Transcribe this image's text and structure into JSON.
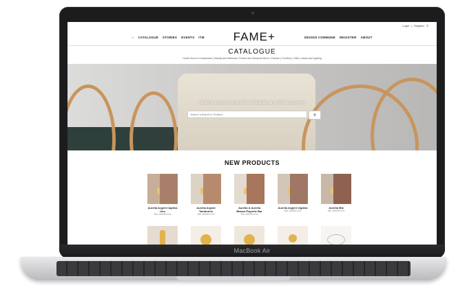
{
  "device": {
    "brand_label": "MacBook Air"
  },
  "site": {
    "topbar": {
      "login": "Login",
      "register": "Register"
    },
    "nav": {
      "left": [
        "CATALOGUE",
        "STORIES",
        "EVENTS",
        "ITM"
      ],
      "logo": "FAME+",
      "right": [
        "DESIGN COMMUNE",
        "REGISTER",
        "ABOUT"
      ]
    },
    "catalogue": {
      "title": "CATALOGUE",
      "links": "Home Decor & Housewares | Beauty and Wellness | Festive and Seasonal Decor | Fashion | Furniture | Gifts | Lamps and Lighting"
    },
    "hero": {
      "text": "Search across hundreds of Brands and Products here",
      "search_placeholder": "Search a Brand or Product"
    },
    "new_products": {
      "title": "NEW PRODUCTS",
      "items": [
        {
          "name": "Aurelia Argent Captiva Uno",
          "brand": "MA. ANGELICA"
        },
        {
          "name": "Aurelia Argent Tamborine",
          "brand": "MA. ANGELICA"
        },
        {
          "name": "Aurelia & Aurelia Blanca Paynete Bar",
          "brand": "MA. ANGELICA"
        },
        {
          "name": "Aurelia Argent Captiva",
          "brand": "MA. ANGELICA"
        },
        {
          "name": "Aurelia Mia",
          "brand": "MA. ANGELICA"
        }
      ]
    }
  }
}
